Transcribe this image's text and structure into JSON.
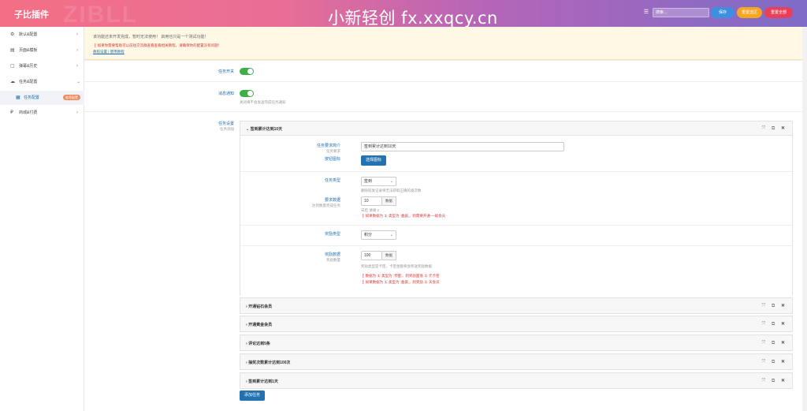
{
  "header": {
    "brand": "子比插件",
    "brand_ghost": "ZIBLL",
    "watermark": "小新轻创 fx.xxqcy.cn",
    "search_placeholder": "搜索...",
    "save_label": "保存",
    "reset_section_label": "重置选区",
    "reset_all_label": "重置全部"
  },
  "sidebar": {
    "items": [
      {
        "label": "默认&配置",
        "icon": "gear-icon"
      },
      {
        "label": "页面&模板",
        "icon": "page-icon"
      },
      {
        "label": "弹幕&历史",
        "icon": "chat-icon"
      },
      {
        "label": "任务&配置",
        "icon": "cloud-icon"
      },
      {
        "label": "商城&付费",
        "icon": "coin-icon"
      }
    ],
    "sub_item": {
      "label": "任务配置",
      "badge": "推荐配置"
    }
  },
  "notice": {
    "line1": "该功能还未开发完成，暂时无法使用！ 启用也只是一个测试功能！",
    "line2": "❗如果你需要帮助可以前往交流群查看查看相关教程，请确保你的配置没有问题！",
    "line3": "教程设置 | 使用教程"
  },
  "options": {
    "task_switch": {
      "label": "任务开关"
    },
    "message_notify": {
      "label": "消息通知",
      "help": "关闭将不会发送完成任务通知"
    },
    "task_settings": {
      "label": "任务设置",
      "desc": "任务添加"
    }
  },
  "accordion_open": {
    "title": "签到累计达到10天",
    "tools": "⤧ ⧉ ✖",
    "fields": {
      "intro": {
        "label": "任务要求简介",
        "desc": "任务要求",
        "value": "签到累计达到10天"
      },
      "icon": {
        "label": "按钮图标",
        "button": "选择图标"
      },
      "type": {
        "label": "任务类型",
        "value": "签到",
        "help": "删除就发记录将无法获取正确的发次数"
      },
      "require": {
        "label": "要求数据",
        "desc": "达到数量完成任务",
        "value": "10",
        "unit": "数据",
        "help": "日后 请填 2",
        "warn_prefix": "❗如果数据为",
        "warn_code1": "1",
        "warn_mid": "类型为",
        "warn_code2": "会员",
        "warn_suffix": "，则需要开通 一级会员"
      },
      "reward_type": {
        "label": "奖励类型",
        "value": "积分"
      },
      "reward_data": {
        "label": "奖励数据",
        "desc": "奖励数量",
        "value": "100",
        "unit": "数据",
        "help": "奖励类型是卡密，卡密金额将会移送奖励数据",
        "warn1_prefix": "❗数据为",
        "warn1_code1": "1",
        "warn1_mid": "类型为",
        "warn1_code2": "卡密",
        "warn1_suffix": "，则奖励面值",
        "warn1_code3": "1",
        "warn1_end": "元卡密",
        "warn2_prefix": "❗如果数据为",
        "warn2_code1": "1",
        "warn2_mid": "类型为",
        "warn2_code2": "会员",
        "warn2_suffix": "，则奖励",
        "warn2_code3": "1",
        "warn2_end": "天会员"
      }
    }
  },
  "accordions_closed": [
    {
      "title": "开通钻石会员"
    },
    {
      "title": "开通黄金会员"
    },
    {
      "title": "评论达到5条"
    },
    {
      "title": "抽奖次数累计达到100次"
    },
    {
      "title": "签到累计达到1天"
    }
  ],
  "add_task_label": "添加任务"
}
